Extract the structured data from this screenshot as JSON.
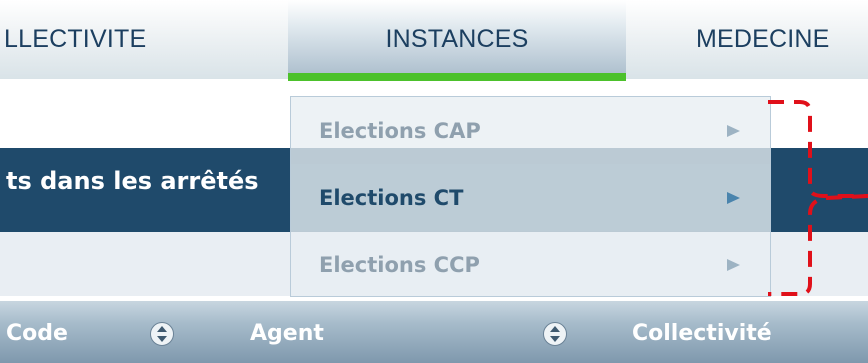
{
  "topnav": {
    "items": [
      {
        "label": "LLECTIVITE"
      },
      {
        "label": "INSTANCES"
      },
      {
        "label": "MEDECINE"
      }
    ]
  },
  "banner": {
    "text": "ts dans les arrêtés"
  },
  "table_header": {
    "col1": "Code",
    "col2": "Agent",
    "col3": "Collectivité"
  },
  "dropdown": {
    "items": [
      {
        "label": "Elections CAP",
        "state": "normal"
      },
      {
        "label": "Elections CT",
        "state": "hover"
      },
      {
        "label": "Elections CCP",
        "state": "normal"
      }
    ]
  },
  "colors": {
    "active_indicator": "#4cc12b",
    "dark_band": "#1f4a6b",
    "annotation": "#e0101a"
  }
}
